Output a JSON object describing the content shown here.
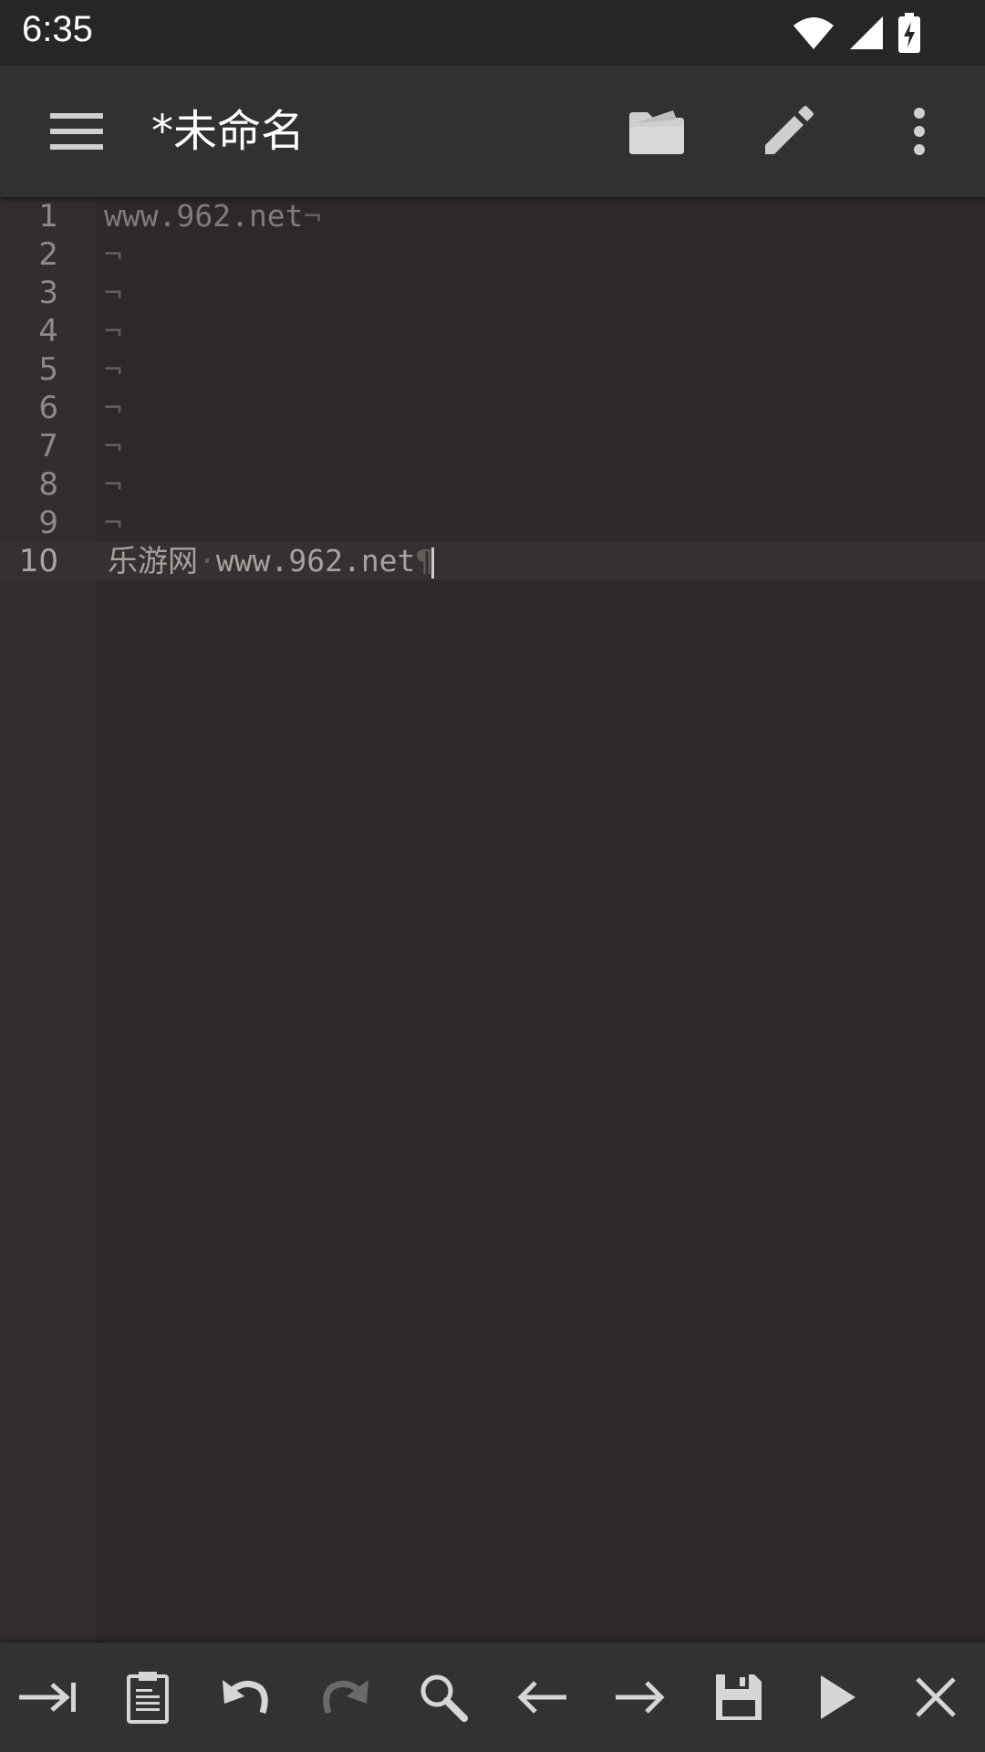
{
  "status_bar": {
    "time": "6:35",
    "icons": [
      "wifi-icon",
      "signal-icon",
      "battery-charging-icon"
    ]
  },
  "app_bar": {
    "title": "*未命名",
    "icons": [
      "menu-icon",
      "folder-open-icon",
      "pencil-icon",
      "more-vert-icon"
    ]
  },
  "editor": {
    "lines": [
      {
        "number": "1",
        "text": "www.962.net",
        "end": "¬"
      },
      {
        "number": "2",
        "text": "",
        "end": "¬"
      },
      {
        "number": "3",
        "text": "",
        "end": "¬"
      },
      {
        "number": "4",
        "text": "",
        "end": "¬"
      },
      {
        "number": "5",
        "text": "",
        "end": "¬"
      },
      {
        "number": "6",
        "text": "",
        "end": "¬"
      },
      {
        "number": "7",
        "text": "",
        "end": "¬"
      },
      {
        "number": "8",
        "text": "",
        "end": "¬"
      },
      {
        "number": "9",
        "text": "",
        "end": "¬"
      },
      {
        "number": "10",
        "text_a": "乐游网",
        "separator": "·",
        "text_b": "www.962.net",
        "end": "¶"
      }
    ],
    "current_line": "10"
  },
  "toolbar": {
    "items": [
      "tab-icon",
      "clipboard-icon",
      "undo-icon",
      "redo-icon",
      "search-icon",
      "arrow-left-icon",
      "arrow-right-icon",
      "save-icon",
      "play-icon",
      "close-icon"
    ],
    "colors": {
      "enabled": "#d6d6d6",
      "disabled": "#6a6a6a"
    }
  }
}
